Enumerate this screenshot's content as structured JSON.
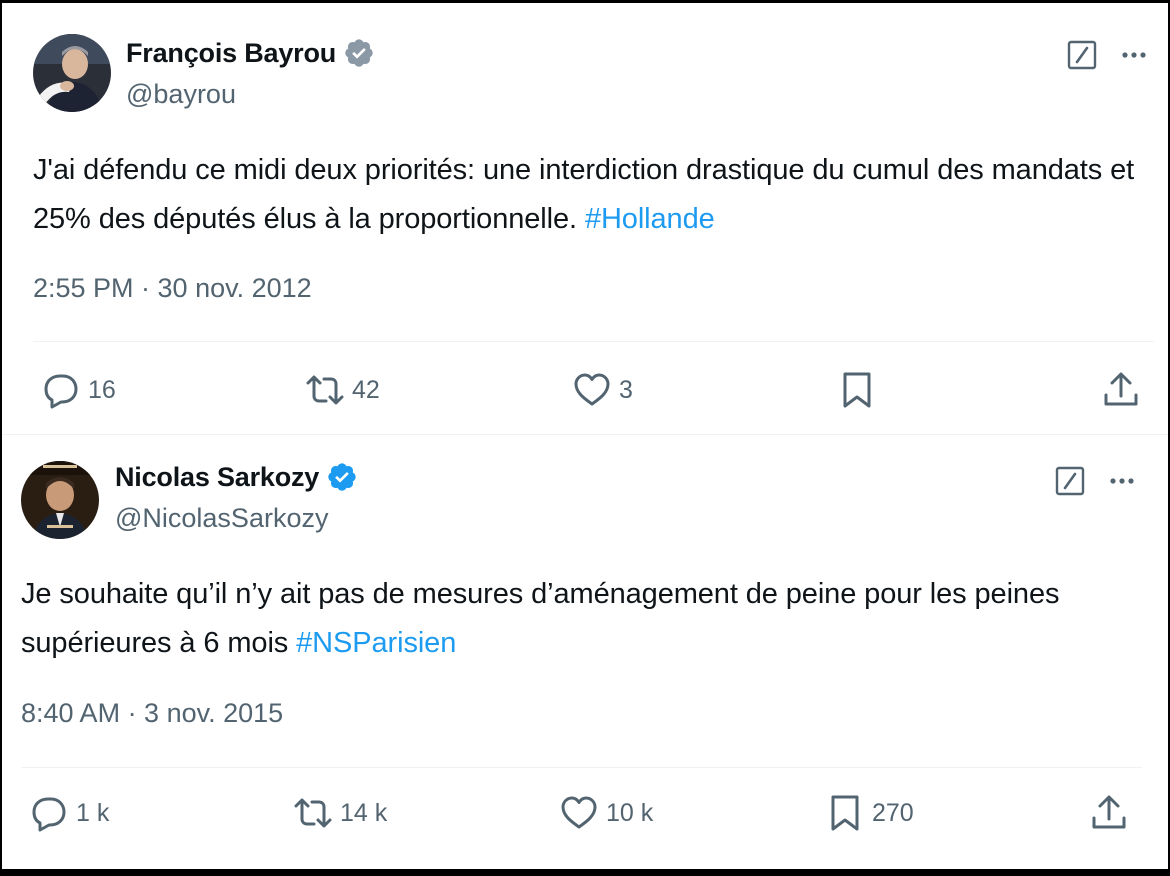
{
  "tweets": [
    {
      "author": {
        "name": "François Bayrou",
        "handle": "@bayrou",
        "avatar_icon": "avatar-photo-bayrou"
      },
      "text": "J'ai défendu ce midi deux priorités: une interdiction drastique du cumul des mandats et 25% des députés élus à la proportionnelle.",
      "hashtag": "#Hollande",
      "timestamp": "2:55 PM · 30 nov. 2012",
      "actions": {
        "replies": "16",
        "reposts": "42",
        "likes": "3",
        "bookmarks": ""
      }
    },
    {
      "author": {
        "name": "Nicolas Sarkozy",
        "handle": "@NicolasSarkozy",
        "avatar_icon": "avatar-photo-sarkozy"
      },
      "text": "Je souhaite qu’il n’y ait pas de mesures d’aménagement de peine pour les peines supérieures à 6 mois",
      "hashtag": "#NSParisien",
      "timestamp": "8:40 AM · 3 nov. 2015",
      "actions": {
        "replies": "1 k",
        "reposts": "14 k",
        "likes": "10 k",
        "bookmarks": "270"
      }
    }
  ],
  "colors": {
    "text": "#0f1419",
    "secondary": "#536471",
    "link": "#1d9bf0",
    "verified": "#1d9bf0",
    "divider": "#eff3f4"
  },
  "icons": [
    "verified-badge-icon",
    "grok-icon",
    "more-icon",
    "reply-icon",
    "repost-icon",
    "like-icon",
    "bookmark-icon",
    "share-icon"
  ]
}
